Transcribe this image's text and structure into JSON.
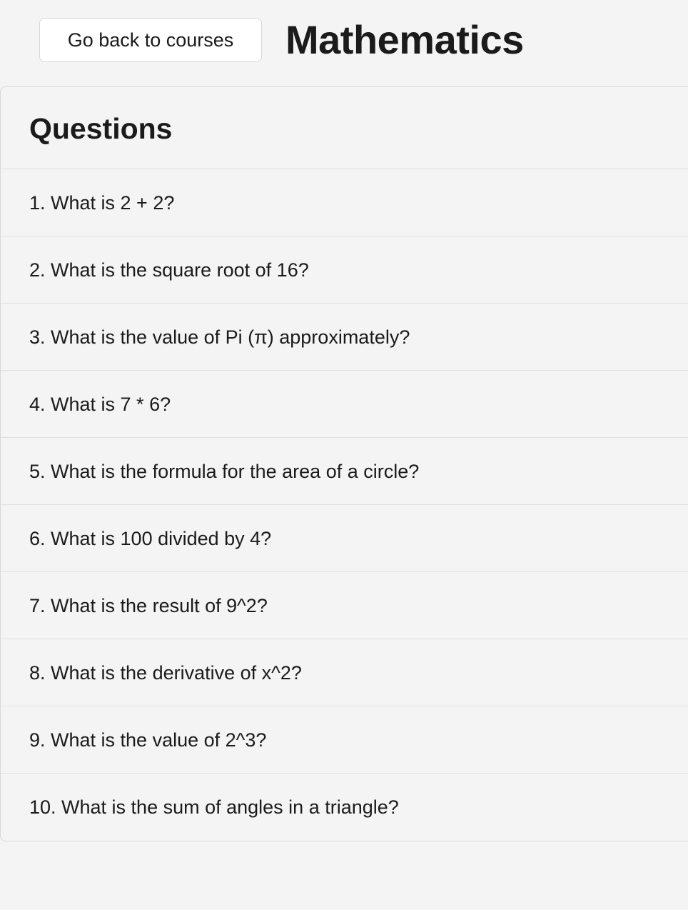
{
  "header": {
    "back_button_label": "Go back to courses",
    "title": "Mathematics"
  },
  "questions": {
    "heading": "Questions",
    "items": [
      "1. What is 2 + 2?",
      "2. What is the square root of 16?",
      "3. What is the value of Pi (π) approximately?",
      "4. What is 7 * 6?",
      "5. What is the formula for the area of a circle?",
      "6. What is 100 divided by 4?",
      "7. What is the result of 9^2?",
      "8. What is the derivative of x^2?",
      "9. What is the value of 2^3?",
      "10. What is the sum of angles in a triangle?"
    ]
  }
}
